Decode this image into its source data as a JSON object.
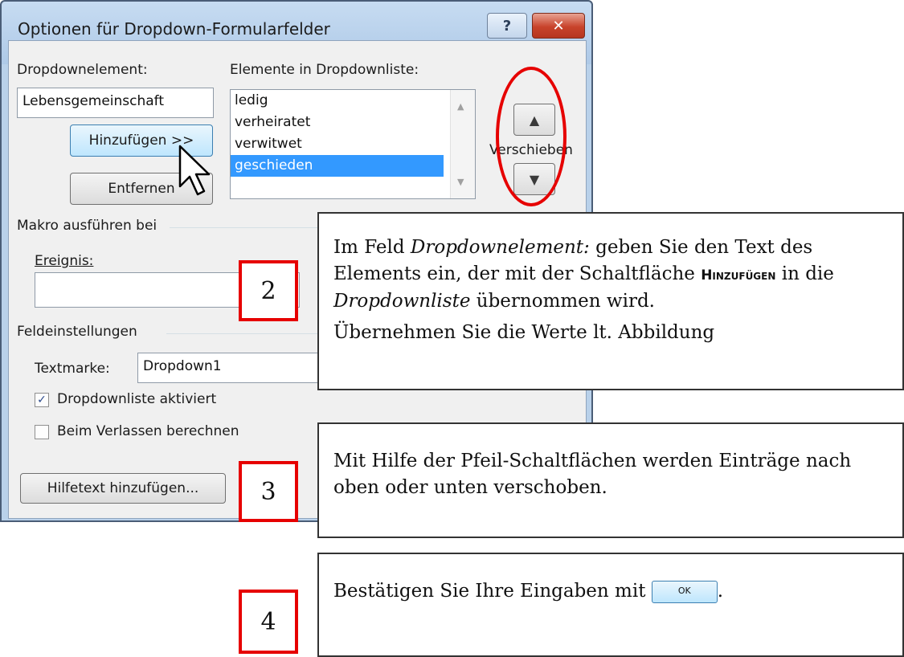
{
  "dialog": {
    "title": "Optionen für Dropdown-Formularfelder",
    "help_glyph": "?",
    "close_glyph": "✕",
    "dropdown_element_label": "Dropdownelement:",
    "dropdown_element_value": "Lebensgemeinschaft",
    "add_button": "Hinzufügen >>",
    "remove_button": "Entfernen",
    "list_label": "Elemente in Dropdownliste:",
    "list_items": [
      "ledig",
      "verheiratet",
      "verwitwet",
      "geschieden"
    ],
    "selected_index": 3,
    "move_label": "Verschieben",
    "macro_group": "Makro ausführen bei",
    "event_label": "Ereignis:",
    "event_value": "",
    "field_settings_group": "Feldeinstellungen",
    "bookmark_label": "Textmarke:",
    "bookmark_value": "Dropdown1",
    "checkbox_enabled_label": "Dropdownliste aktiviert",
    "checkbox_enabled_checked": true,
    "checkbox_calc_label": "Beim Verlassen berechnen",
    "checkbox_calc_checked": false,
    "help_text_button": "Hilfetext hinzufügen..."
  },
  "annotations": {
    "step2": {
      "number": "2",
      "text_pre": "Im Feld ",
      "text_italic1": "Dropdownelement:",
      "text_mid": " geben Sie den Text des Elements ein, der mit der Schaltfläche ",
      "text_bold": "Hinzufügen",
      "text_mid2": " in die ",
      "text_italic2": "Dropdownliste",
      "text_post": " übernommen wird.",
      "text_line2": "Übernehmen Sie die Werte lt. Abbildung"
    },
    "step3": {
      "number": "3",
      "text": "Mit Hilfe der Pfeil-Schaltflächen werden Einträge nach oben oder unten verschoben."
    },
    "step4": {
      "number": "4",
      "text_pre": "Bestätigen Sie Ihre Eingaben mit ",
      "ok_label": "OK",
      "text_post": "."
    }
  },
  "colors": {
    "annotation_red": "#e60000",
    "selection_blue": "#3399ff"
  }
}
